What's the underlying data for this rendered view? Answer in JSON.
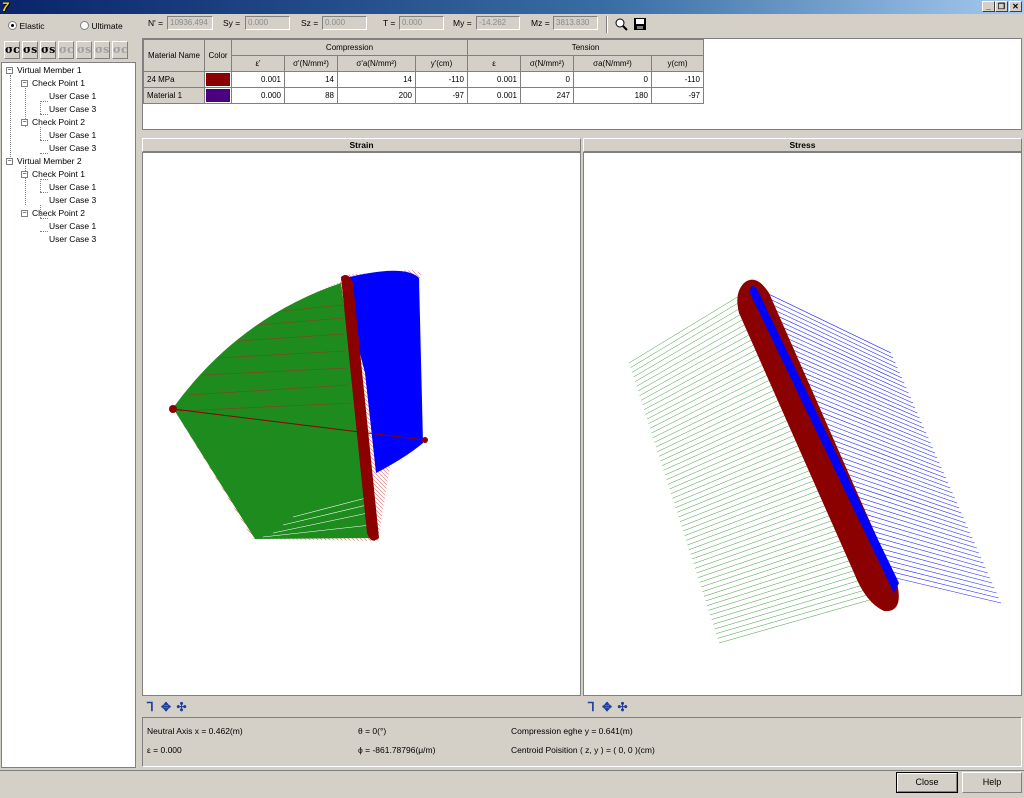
{
  "window": {
    "app_icon": "7"
  },
  "mode": {
    "elastic_label": "Elastic",
    "ultimate_label": "Ultimate",
    "selected": "Elastic"
  },
  "forces": [
    {
      "label": "N' =",
      "value": "10936.494"
    },
    {
      "label": "Sy =",
      "value": "0.000"
    },
    {
      "label": "Sz =",
      "value": "0.000"
    },
    {
      "label": "T =",
      "value": "0.000"
    },
    {
      "label": "My =",
      "value": "-14.262"
    },
    {
      "label": "Mz =",
      "value": "3813.830"
    }
  ],
  "stress_buttons": [
    "σc",
    "σs",
    "σs",
    "σc",
    "σs",
    "σs",
    "σc"
  ],
  "tree": {
    "members": [
      {
        "label": "Virtual Member 1",
        "points": [
          {
            "label": "Check Point  1",
            "cases": [
              "User Case 1",
              "User Case 3"
            ]
          },
          {
            "label": "Check Point  2",
            "cases": [
              "User Case 1",
              "User Case 3"
            ]
          }
        ]
      },
      {
        "label": "Virtual Member 2",
        "points": [
          {
            "label": "Check Point  1",
            "cases": [
              "User Case 1",
              "User Case 3"
            ]
          },
          {
            "label": "Check Point  2",
            "cases": [
              "User Case 1",
              "User Case 3"
            ]
          }
        ]
      }
    ]
  },
  "table": {
    "group_headers": {
      "compression": "Compression",
      "tension": "Tension"
    },
    "headers": [
      "Material Name",
      "Color",
      "ε'",
      "σ'(N/mm²)",
      "σ'a(N/mm²)",
      "y'(cm)",
      "ε",
      "σ(N/mm²)",
      "σa(N/mm²)",
      "y(cm)"
    ],
    "rows": [
      {
        "name": "24 MPa",
        "color": "#8b0000",
        "values": [
          "0.001",
          "14",
          "14",
          "-110",
          "0.001",
          "0",
          "0",
          "-110"
        ]
      },
      {
        "name": "Material 1",
        "color": "#4b0082",
        "values": [
          "0.000",
          "88",
          "200",
          "-97",
          "0.001",
          "247",
          "180",
          "-97"
        ]
      }
    ]
  },
  "panels": {
    "strain_title": "Strain",
    "stress_title": "Stress"
  },
  "status": {
    "neutral_axis": "Neutral Axis x = 0.462(m)",
    "theta": "θ = 0(°)",
    "compression_edge": "Compression eghe y = 0.641(m)",
    "epsilon": "ε = 0.000",
    "phi": "ϕ = -861.78796(μ/m)",
    "centroid": "Centroid Poisition ( z, y ) = ( 0, 0 )(cm)"
  },
  "buttons": {
    "close": "Close",
    "help": "Help"
  },
  "colors": {
    "compression": "#1e8b1e",
    "tension": "#0000ff",
    "section": "#8b0000"
  }
}
